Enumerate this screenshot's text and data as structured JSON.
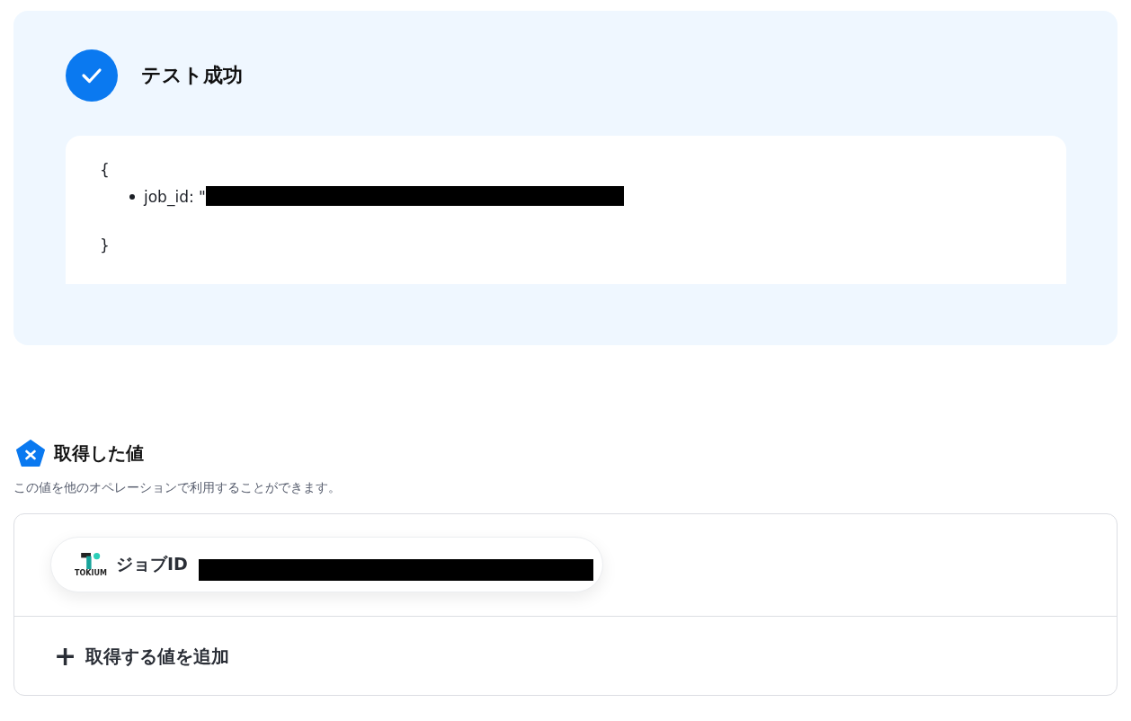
{
  "test_result": {
    "succeeded": true,
    "title": "テスト成功",
    "open_brace": "{",
    "fields": [
      {
        "key": "job_id: \"",
        "redacted": true
      }
    ],
    "close_brace": "}"
  },
  "retrieved_values": {
    "title": "取得した値",
    "description": "この値を他のオペレーションで利用することができます。",
    "items": [
      {
        "logo_text": "TOKIUM",
        "label": "ジョブID",
        "redacted": true
      }
    ],
    "add_button": {
      "icon": "+",
      "label": "取得する値を追加"
    }
  }
}
